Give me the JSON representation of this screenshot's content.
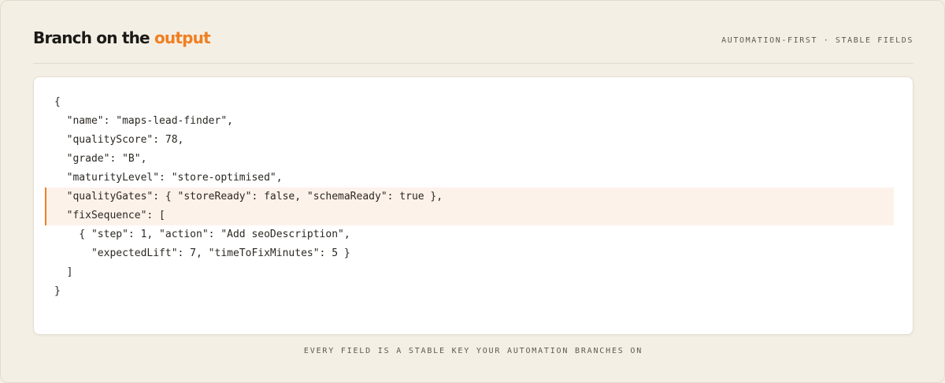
{
  "header": {
    "title_prefix": "Branch on the ",
    "title_accent": "output",
    "tagline": "AUTOMATION-FIRST · STABLE FIELDS"
  },
  "code": {
    "lines": [
      {
        "text": "{",
        "highlighted": false
      },
      {
        "text": "  \"name\": \"maps-lead-finder\",",
        "highlighted": false
      },
      {
        "text": "  \"qualityScore\": 78,",
        "highlighted": false
      },
      {
        "text": "  \"grade\": \"B\",",
        "highlighted": false
      },
      {
        "text": "  \"maturityLevel\": \"store-optimised\",",
        "highlighted": false
      },
      {
        "text": "  \"qualityGates\": { \"storeReady\": false, \"schemaReady\": true },",
        "highlighted": true
      },
      {
        "text": "  \"fixSequence\": [",
        "highlighted": true
      },
      {
        "text": "    { \"step\": 1, \"action\": \"Add seoDescription\",",
        "highlighted": false
      },
      {
        "text": "      \"expectedLift\": 7, \"timeToFixMinutes\": 5 }",
        "highlighted": false
      },
      {
        "text": "  ]",
        "highlighted": false
      },
      {
        "text": "}",
        "highlighted": false
      }
    ]
  },
  "footer": {
    "caption": "EVERY FIELD IS A STABLE KEY YOUR AUTOMATION BRANCHES ON"
  },
  "colors": {
    "accent": "#f07f22",
    "background": "#f4efe4",
    "card": "#ffffff",
    "highlight": "#fdf2ea"
  }
}
